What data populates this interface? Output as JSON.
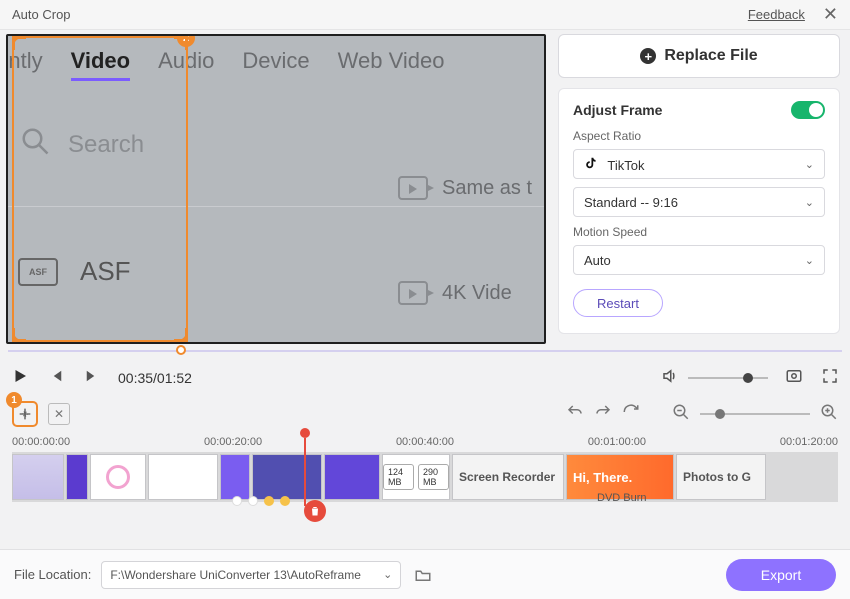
{
  "window": {
    "title": "Auto Crop",
    "feedback": "Feedback"
  },
  "annotations": {
    "badge1": "1",
    "badge2": "2"
  },
  "preview": {
    "tabs": {
      "t0": "tently",
      "t1": "Video",
      "t2": "Audio",
      "t3": "Device",
      "t4": "Web Video"
    },
    "search_placeholder": "Search",
    "format_label": "ASF",
    "format_badge": "ASF",
    "row_same": "Same as t",
    "row_4k": "4K Vide"
  },
  "sidebar": {
    "replace_label": "Replace File",
    "panel_title": "Adjust Frame",
    "aspect_label": "Aspect Ratio",
    "aspect_value": "TikTok",
    "ratio_value": "Standard -- 9:16",
    "motion_label": "Motion Speed",
    "motion_value": "Auto",
    "restart_label": "Restart"
  },
  "player": {
    "time": "00:35/01:52"
  },
  "timeline": {
    "marks": [
      "00:00:00:00",
      "00:00:20:00",
      "00:00:40:00",
      "00:01:00:00",
      "00:01:20:00"
    ],
    "chip1": "124 MB",
    "chip2": "290 MB",
    "label_screen": "Screen Recorder",
    "label_hi": "Hi, There.",
    "label_photos": "Photos to G",
    "label_dvd": "DVD Burn"
  },
  "footer": {
    "label": "File Location:",
    "path": "F:\\Wondershare UniConverter 13\\AutoReframe",
    "export_label": "Export"
  }
}
